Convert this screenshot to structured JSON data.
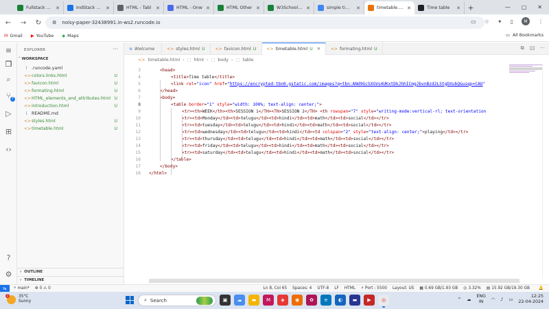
{
  "browser": {
    "tabs": [
      {
        "label": "Fullstack Lea",
        "color": "#188038"
      },
      {
        "label": "IndStack Aca",
        "color": "#1a73e8"
      },
      {
        "label": "HTML - Tabl",
        "color": "#5f6368"
      },
      {
        "label": "HTML - Onw",
        "color": "#4b6ae8"
      },
      {
        "label": "HTML Other",
        "color": "#188038"
      },
      {
        "label": "W3Schools T",
        "color": "#188038"
      },
      {
        "label": "simple timet",
        "color": "#4285f4"
      },
      {
        "label": "timetable.htr",
        "color": "#e8710a",
        "active": true
      },
      {
        "label": "Time table",
        "color": "#202124"
      }
    ],
    "new_tab": "+",
    "controls": {
      "minimize": "—",
      "maximize": "▢",
      "close": "✕"
    },
    "url": "noisy-paper-32438991.in-ws2.runcode.io",
    "avatar": "M",
    "bookmarks": [
      {
        "label": "Gmail",
        "icon": "M",
        "color": "#d93025"
      },
      {
        "label": "YouTube",
        "icon": "▶",
        "color": "#ff0000"
      },
      {
        "label": "Maps",
        "icon": "◆",
        "color": "#34a853"
      }
    ],
    "all_bookmarks": "All Bookmarks"
  },
  "explorer": {
    "title": "EXPLORER",
    "workspace": "WORKSPACE",
    "files": [
      {
        "name": ".runcode.yaml",
        "icon": "!",
        "status": "",
        "green": false
      },
      {
        "name": "colors.links.html",
        "icon": "<>",
        "status": "U",
        "green": true
      },
      {
        "name": "favicon.html",
        "icon": "<>",
        "status": "U",
        "green": true
      },
      {
        "name": "formating.html",
        "icon": "<>",
        "status": "U",
        "green": true
      },
      {
        "name": "HTML_elements_and_attributes.html",
        "icon": "<>",
        "status": "U",
        "green": true
      },
      {
        "name": "introduction.html",
        "icon": "<>",
        "status": "U",
        "green": true
      },
      {
        "name": "README.md",
        "icon": "i",
        "status": "",
        "green": false
      },
      {
        "name": "styles.html",
        "icon": "<>",
        "status": "U",
        "green": true
      },
      {
        "name": "timetable.html",
        "icon": "<>",
        "status": "U",
        "green": true
      }
    ],
    "outline": "OUTLINE",
    "timeline": "TIMELINE"
  },
  "editor_tabs": [
    {
      "label": "Welcome",
      "icon": "≋",
      "status": "",
      "active": false
    },
    {
      "label": "styles.html",
      "icon": "<>",
      "status": "U",
      "active": false
    },
    {
      "label": "favicon.html",
      "icon": "<>",
      "status": "U",
      "active": false
    },
    {
      "label": "timetable.html",
      "icon": "<>",
      "status": "U",
      "active": true
    },
    {
      "label": "formating.html",
      "icon": "<>",
      "status": "U",
      "active": false
    }
  ],
  "breadcrumb": [
    "timetable.html",
    "html",
    "body",
    "table"
  ],
  "code_lines": [
    {
      "n": "3",
      "indent": 1,
      "tokens": [
        [
          "tg",
          "<head>"
        ]
      ]
    },
    {
      "n": "4",
      "indent": 2,
      "tokens": [
        [
          "tg",
          "<title>"
        ],
        [
          "tx",
          "Time table"
        ],
        [
          "tg",
          "</title>"
        ]
      ]
    },
    {
      "n": "5",
      "indent": 2,
      "tokens": [
        [
          "tg",
          "<link "
        ],
        [
          "at",
          "rel"
        ],
        [
          "tx",
          "="
        ],
        [
          "sv",
          "\"icon\" "
        ],
        [
          "at",
          "href"
        ],
        [
          "tx",
          "="
        ],
        [
          "sv",
          "\""
        ],
        [
          "lk",
          "https://encrypted-tbn0.gstatic.com/images?q=tbn:ANd9GcSXGVs4UKxtDkJhhICmgJbvnBzd2LStgDXubQ&usqp=CAU"
        ],
        [
          "sv",
          "\""
        ]
      ]
    },
    {
      "n": "6",
      "indent": 1,
      "tokens": [
        [
          "tg",
          "</head>"
        ]
      ]
    },
    {
      "n": "7",
      "indent": 1,
      "tokens": [
        [
          "tg",
          "<body>"
        ]
      ]
    },
    {
      "n": "8",
      "indent": 2,
      "cur": true,
      "tokens": [
        [
          "tg",
          "<table "
        ],
        [
          "at",
          "border"
        ],
        [
          "tx",
          "="
        ],
        [
          "sv",
          "\"1\" "
        ],
        [
          "at",
          "style"
        ],
        [
          "tx",
          "="
        ],
        [
          "sv",
          "\"width: 100%; text-align: center;\""
        ],
        [
          "tg",
          ">"
        ]
      ]
    },
    {
      "n": "9",
      "indent": 3,
      "tokens": [
        [
          "tg",
          "<tr><th>"
        ],
        [
          "tx",
          "WEEK"
        ],
        [
          "tg",
          "</th><th>"
        ],
        [
          "tx",
          "SESSION 1"
        ],
        [
          "tg",
          "</TH><TH>"
        ],
        [
          "tx",
          "SESSION 2"
        ],
        [
          "tg",
          "</TH> <th "
        ],
        [
          "at",
          "rowspan"
        ],
        [
          "tx",
          "="
        ],
        [
          "sv",
          "\"7\" "
        ],
        [
          "at",
          "style"
        ],
        [
          "tx",
          "="
        ],
        [
          "sv",
          "\"writing-mode:vertical-rl; text-orientation"
        ]
      ]
    },
    {
      "n": "10",
      "indent": 3,
      "tokens": [
        [
          "tg",
          "<tr><td>"
        ],
        [
          "tx",
          "Monday"
        ],
        [
          "tg",
          "</td><td>"
        ],
        [
          "tx",
          "telugu"
        ],
        [
          "tg",
          "</td><td>"
        ],
        [
          "tx",
          "hindi"
        ],
        [
          "tg",
          "</td><td>"
        ],
        [
          "tx",
          "math"
        ],
        [
          "tg",
          "</td><td>"
        ],
        [
          "tx",
          "social"
        ],
        [
          "tg",
          "</td></tr>"
        ]
      ]
    },
    {
      "n": "11",
      "indent": 3,
      "tokens": [
        [
          "tg",
          "<tr><td>"
        ],
        [
          "tx",
          "tuesday"
        ],
        [
          "tg",
          "</td><td>"
        ],
        [
          "tx",
          "telugu"
        ],
        [
          "tg",
          "</td><td>"
        ],
        [
          "tx",
          "hindi"
        ],
        [
          "tg",
          "</td><td>"
        ],
        [
          "tx",
          "math"
        ],
        [
          "tg",
          "</td><td>"
        ],
        [
          "tx",
          "social"
        ],
        [
          "tg",
          "</td></tr>"
        ]
      ]
    },
    {
      "n": "12",
      "indent": 3,
      "tokens": [
        [
          "tg",
          "<tr><td>"
        ],
        [
          "tx",
          "wednesday"
        ],
        [
          "tg",
          "</td><td>"
        ],
        [
          "tx",
          "telugu"
        ],
        [
          "tg",
          "</td><td>"
        ],
        [
          "tx",
          "hindi"
        ],
        [
          "tg",
          "</td><td "
        ],
        [
          "at",
          "colspan"
        ],
        [
          "tx",
          "="
        ],
        [
          "sv",
          "\"2\" "
        ],
        [
          "at",
          "style"
        ],
        [
          "tx",
          "="
        ],
        [
          "sv",
          "\"text-align: center;\""
        ],
        [
          "tg",
          ">"
        ],
        [
          "tx",
          "playing"
        ],
        [
          "tg",
          "</td></tr>"
        ]
      ]
    },
    {
      "n": "13",
      "indent": 3,
      "tokens": [
        [
          "tg",
          "<tr><td>"
        ],
        [
          "tx",
          "thursday"
        ],
        [
          "tg",
          "</td><td>"
        ],
        [
          "tx",
          "telugu"
        ],
        [
          "tg",
          "</td><td>"
        ],
        [
          "tx",
          "hindi"
        ],
        [
          "tg",
          "</td><td>"
        ],
        [
          "tx",
          "math"
        ],
        [
          "tg",
          "</td><td>"
        ],
        [
          "tx",
          "social"
        ],
        [
          "tg",
          "</td></tr>"
        ]
      ]
    },
    {
      "n": "14",
      "indent": 3,
      "tokens": [
        [
          "tg",
          "<tr><td>"
        ],
        [
          "tx",
          "friday"
        ],
        [
          "tg",
          "</td><td>"
        ],
        [
          "tx",
          "telugu"
        ],
        [
          "tg",
          "</td><td>"
        ],
        [
          "tx",
          "hindi"
        ],
        [
          "tg",
          "</td><td>"
        ],
        [
          "tx",
          "math"
        ],
        [
          "tg",
          "</td><td>"
        ],
        [
          "tx",
          "social"
        ],
        [
          "tg",
          "</td></tr>"
        ]
      ]
    },
    {
      "n": "15",
      "indent": 3,
      "tokens": [
        [
          "tg",
          "<tr><td>"
        ],
        [
          "tx",
          "saturday"
        ],
        [
          "tg",
          "</td><td>"
        ],
        [
          "tx",
          "telugu"
        ],
        [
          "tg",
          "</td><td>"
        ],
        [
          "tx",
          "hindi"
        ],
        [
          "tg",
          "</td><td>"
        ],
        [
          "tx",
          "math"
        ],
        [
          "tg",
          "</td><td>"
        ],
        [
          "tx",
          "social"
        ],
        [
          "tg",
          "</td></tr>"
        ]
      ]
    },
    {
      "n": "16",
      "indent": 2,
      "tokens": [
        [
          "tg",
          "</table>"
        ]
      ]
    },
    {
      "n": "17",
      "indent": 1,
      "tokens": [
        [
          "tg",
          "</body>"
        ]
      ]
    },
    {
      "n": "18",
      "indent": 0,
      "tokens": [
        [
          "tg",
          "</html>"
        ]
      ]
    }
  ],
  "status": {
    "branch": "main*",
    "errors": "⊗ 0 ⚠ 0",
    "position": "Ln 8, Col 65",
    "spaces": "Spaces: 4",
    "encoding": "UTF-8",
    "eol": "LF",
    "language": "HTML",
    "port": "Port : 5500",
    "layout": "Layout: US",
    "memory": "0.69 GB/1.93 GB",
    "cpu": "3.32%",
    "disk": "15.92 GB/19.30 GB"
  },
  "taskbar": {
    "temp": "35°C",
    "condition": "Sunny",
    "notif": "1",
    "search": "Search",
    "lang": "ENG",
    "region": "IN",
    "time": "12:25",
    "date": "22-04-2024"
  }
}
